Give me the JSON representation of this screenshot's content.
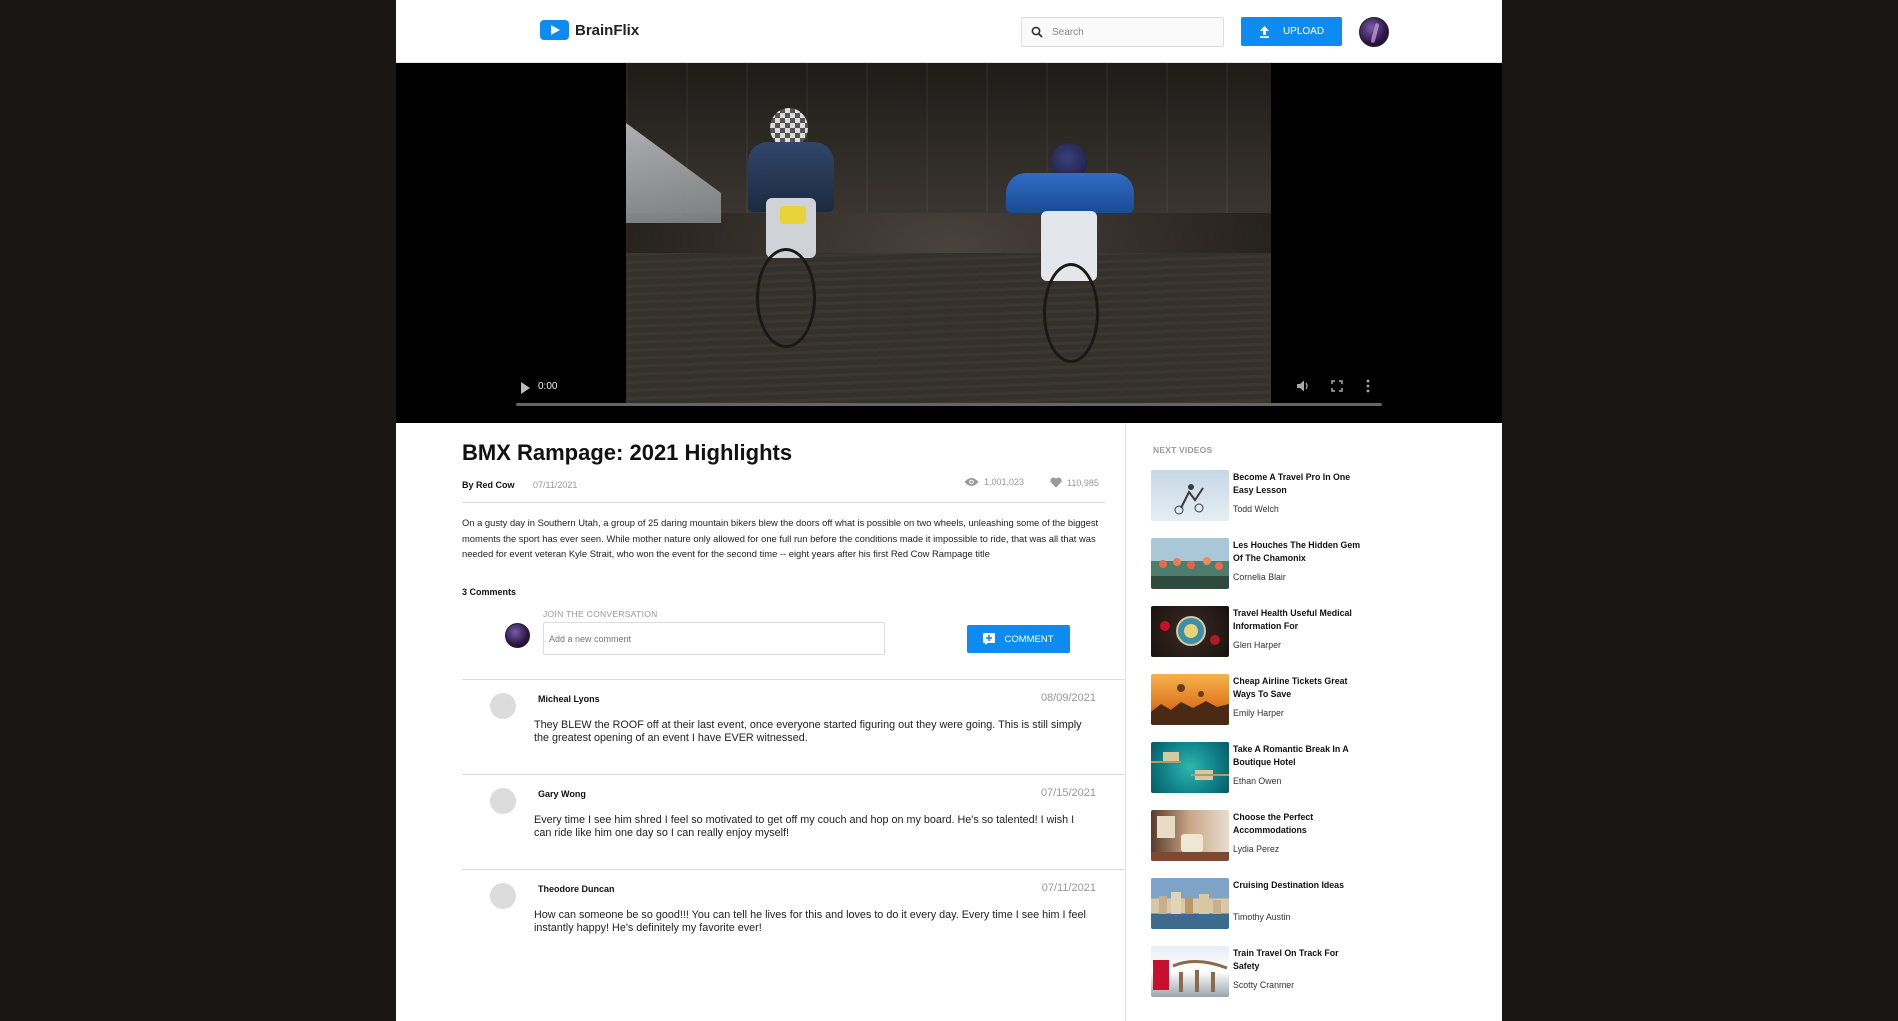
{
  "brand": {
    "name": "BrainFlix",
    "accent": "#0e8bf0"
  },
  "header": {
    "search_placeholder": "Search",
    "upload_label": "UPLOAD"
  },
  "player": {
    "time": "0:00",
    "progress": 0
  },
  "video": {
    "title": "BMX Rampage: 2021 Highlights",
    "byline": "By Red Cow",
    "date": "07/11/2021",
    "views": "1,001,023",
    "likes": "110,985",
    "description": "On a gusty day in Southern Utah, a group of 25 daring mountain bikers blew the doors off what is possible on two wheels, unleashing some of the biggest moments the sport has ever seen. While mother nature only allowed for one full run before the conditions made it impossible to ride, that was all that was needed for event veteran Kyle Strait, who won the event for the second time -- eight years after his first Red Cow Rampage title"
  },
  "comments": {
    "count_label": "3 Comments",
    "join_label": "JOIN THE CONVERSATION",
    "input_placeholder": "Add a new comment",
    "button_label": "COMMENT",
    "items": [
      {
        "name": "Micheal Lyons",
        "date": "08/09/2021",
        "text": "They BLEW the ROOF off at their last event, once everyone started figuring out they were going. This is still simply the greatest opening of an event I have EVER witnessed."
      },
      {
        "name": "Gary Wong",
        "date": "07/15/2021",
        "text": "Every time I see him shred I feel so motivated to get off my couch and hop on my board. He's so talented! I wish I can ride like him one day so I can really enjoy myself!"
      },
      {
        "name": "Theodore Duncan",
        "date": "07/11/2021",
        "text": "How can someone be so good!!! You can tell he lives for this and loves to do it every day. Every time I see him I feel instantly happy! He's definitely my favorite ever!"
      }
    ]
  },
  "sidebar": {
    "label": "NEXT VIDEOS",
    "items": [
      {
        "title": "Become A Travel Pro In One Easy Lesson",
        "author": "Todd Welch"
      },
      {
        "title": "Les Houches The Hidden Gem Of The Chamonix",
        "author": "Cornelia Blair"
      },
      {
        "title": "Travel Health Useful Medical Information For",
        "author": "Glen Harper"
      },
      {
        "title": "Cheap Airline Tickets Great Ways To Save",
        "author": "Emily Harper"
      },
      {
        "title": "Take A Romantic Break In A Boutique Hotel",
        "author": "Ethan Owen"
      },
      {
        "title": "Choose the Perfect Accommodations",
        "author": "Lydia Perez"
      },
      {
        "title": "Cruising Destination Ideas",
        "author": "Timothy Austin"
      },
      {
        "title": "Train Travel On Track For Safety",
        "author": "Scotty Cranmer"
      }
    ]
  }
}
